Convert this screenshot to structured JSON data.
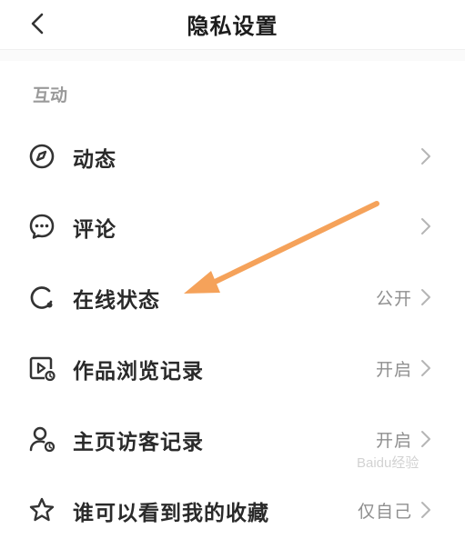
{
  "header": {
    "title": "隐私设置"
  },
  "section": {
    "label": "互动"
  },
  "rows": [
    {
      "label": "动态",
      "value": "",
      "icon": "compass-icon"
    },
    {
      "label": "评论",
      "value": "",
      "icon": "comment-icon"
    },
    {
      "label": "在线状态",
      "value": "公开",
      "icon": "online-status-icon"
    },
    {
      "label": "作品浏览记录",
      "value": "开启",
      "icon": "video-history-icon"
    },
    {
      "label": "主页访客记录",
      "value": "开启",
      "icon": "visitor-icon"
    },
    {
      "label": "谁可以看到我的收藏",
      "value": "仅自己",
      "icon": "favorite-icon"
    }
  ],
  "colors": {
    "annotation_arrow": "#f5a25a",
    "accent_text": "#8f8f8f"
  },
  "watermark": "Baidu经验"
}
